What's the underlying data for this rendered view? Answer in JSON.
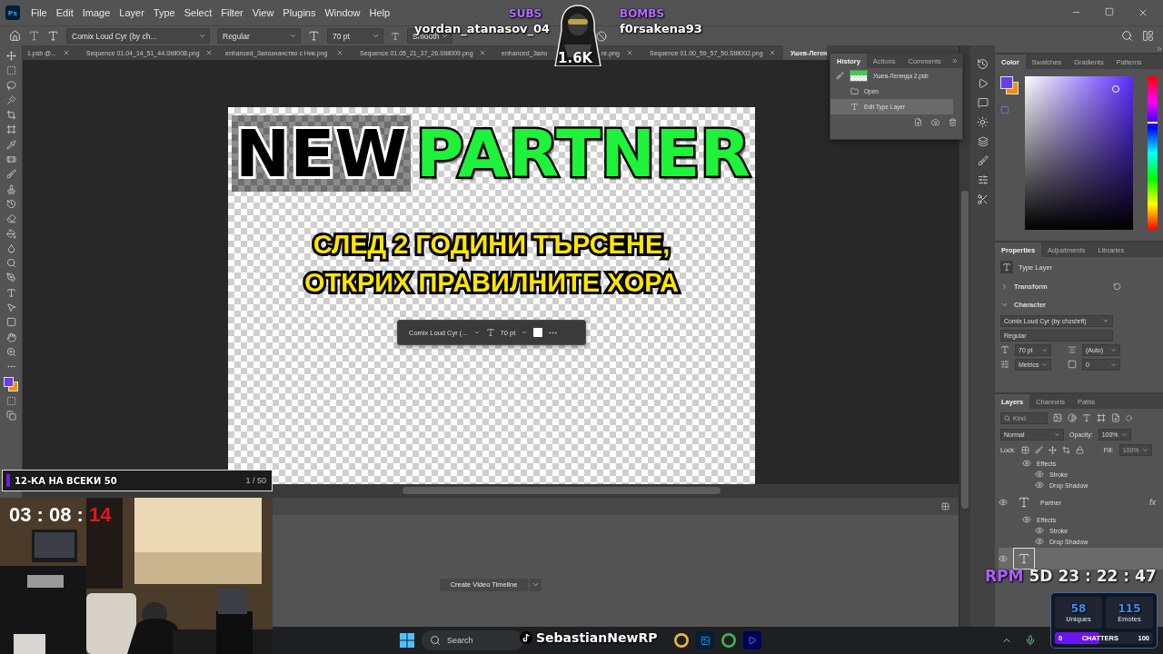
{
  "menu_bar": {
    "app_icon": "Ps",
    "items": [
      "File",
      "Edit",
      "Image",
      "Layer",
      "Type",
      "Select",
      "Filter",
      "View",
      "Plugins",
      "Window",
      "Help"
    ]
  },
  "options_bar": {
    "font": "Comix Loud Cyr (by ch...",
    "style": "Regular",
    "size": "70 pt",
    "antialias": "Smooth"
  },
  "document_tabs": [
    {
      "label": "1.psb @...",
      "selected": false
    },
    {
      "label": "Sequence 01.04_14_51_44.Still008.png",
      "selected": false
    },
    {
      "label": "enhanced_Запознанство с Ник.png",
      "selected": false
    },
    {
      "label": "Sequence 01.05_21_37_26.Still009.png",
      "selected": false
    },
    {
      "label": "enhanced_Запо",
      "tail": "re.png",
      "selected": false
    },
    {
      "label": "Sequence 01.00_59_57_50.Still002.png",
      "selected": false
    },
    {
      "label": "Ушев-Леген",
      "selected": true
    }
  ],
  "history": {
    "tabs": [
      {
        "label": "History",
        "selected": true
      },
      {
        "label": "Actions",
        "selected": false
      },
      {
        "label": "Comments",
        "selected": false
      }
    ],
    "snapshot": "Ушев-Легенда 2.psb",
    "steps": [
      {
        "label": "Open",
        "selected": false
      },
      {
        "label": "Edit Type Layer",
        "selected": true
      }
    ]
  },
  "canvas": {
    "headline": [
      {
        "text": "NEW",
        "kind": "dark"
      },
      {
        "text": "PARTNER",
        "kind": "green"
      }
    ],
    "subtitle": [
      "СЛЕД 2 ГОДИНИ ТЪРСЕНЕ,",
      "ОТКРИХ ПРАВИЛНИТЕ ХОРА"
    ],
    "text_toolbar": {
      "font": "Comix Loud Cyr (...",
      "size": "70 pt"
    }
  },
  "timeline": {
    "button": "Create Video Timeline"
  },
  "color_panel": {
    "tabs": [
      {
        "label": "Color",
        "selected": true
      },
      {
        "label": "Swatches",
        "selected": false
      },
      {
        "label": "Gradients",
        "selected": false
      },
      {
        "label": "Patterns",
        "selected": false
      }
    ],
    "hue": {
      "level": 0.7
    },
    "swatches": [
      {
        "kind": "foreground",
        "color": "#6b3fe3"
      },
      {
        "kind": "background",
        "color": "#f0900a"
      }
    ]
  },
  "properties": {
    "tabs": [
      {
        "label": "Properties",
        "selected": true
      },
      {
        "label": "Adjustments",
        "selected": false
      },
      {
        "label": "Libraries",
        "selected": false
      }
    ],
    "layer_type": "Type Layer",
    "sections": [
      {
        "label": "Transform",
        "expanded": false
      },
      {
        "label": "Character",
        "expanded": true
      }
    ],
    "font": "Comix Loud Cyr (by chzshrft)",
    "style": "Regular",
    "size": "70 pt",
    "leading": "(Auto)",
    "kerning": "Metrics",
    "tracking": "0"
  },
  "layers": {
    "tabs": [
      {
        "label": "Layers",
        "selected": true
      },
      {
        "label": "Channels",
        "selected": false
      },
      {
        "label": "Paths",
        "selected": false
      }
    ],
    "filter": {
      "placeholder": "Kind"
    },
    "blend_mode": "Normal",
    "opacity_label": "Opacity:",
    "opacity": "100%",
    "lock_label": "Lock:",
    "fill_label": "Fill:",
    "fill": "100%",
    "items": [
      {
        "kind": "effects",
        "label": "Effects",
        "visible": true,
        "children": [
          {
            "label": "Stroke",
            "visible": true
          },
          {
            "label": "Drop Shadow",
            "visible": true
          }
        ]
      },
      {
        "kind": "layer",
        "name": "Partner",
        "badge": "fx",
        "visible": true,
        "selected": false
      },
      {
        "kind": "effects",
        "label": "Effects",
        "visible": true,
        "children": [
          {
            "label": "Stroke",
            "visible": true
          },
          {
            "label": "Drop Shadow",
            "visible": true
          }
        ]
      },
      {
        "kind": "layer",
        "visible": true,
        "selected": true
      }
    ]
  },
  "taskbar": {
    "search": {
      "placeholder": "Search"
    }
  },
  "stream_overlay": {
    "subs_label": "SUBS",
    "subs_name": "yordan_atanasov_04",
    "follower_count": "1.6K",
    "bombs_label": "BOMBS",
    "bombs_name": "f0rsakena93",
    "goal_banner": {
      "text": "12-КА НА ВСЕКИ 50",
      "counter": "1 / 50"
    },
    "timer": [
      {
        "text": "03 : 08 : ",
        "kind": "normal"
      },
      {
        "text": "14",
        "kind": "alert"
      }
    ],
    "countdown": {
      "label": "RPM",
      "days": "5D",
      "time": "23 : 22 : 47"
    },
    "stats": [
      {
        "value": "58",
        "label": "Uniques"
      },
      {
        "value": "115",
        "label": "Emotes"
      }
    ],
    "chatters": {
      "min": "0",
      "label": "CHATTERS",
      "max": "100",
      "level": 0.45
    },
    "streamer": "SebastianNewRP"
  }
}
